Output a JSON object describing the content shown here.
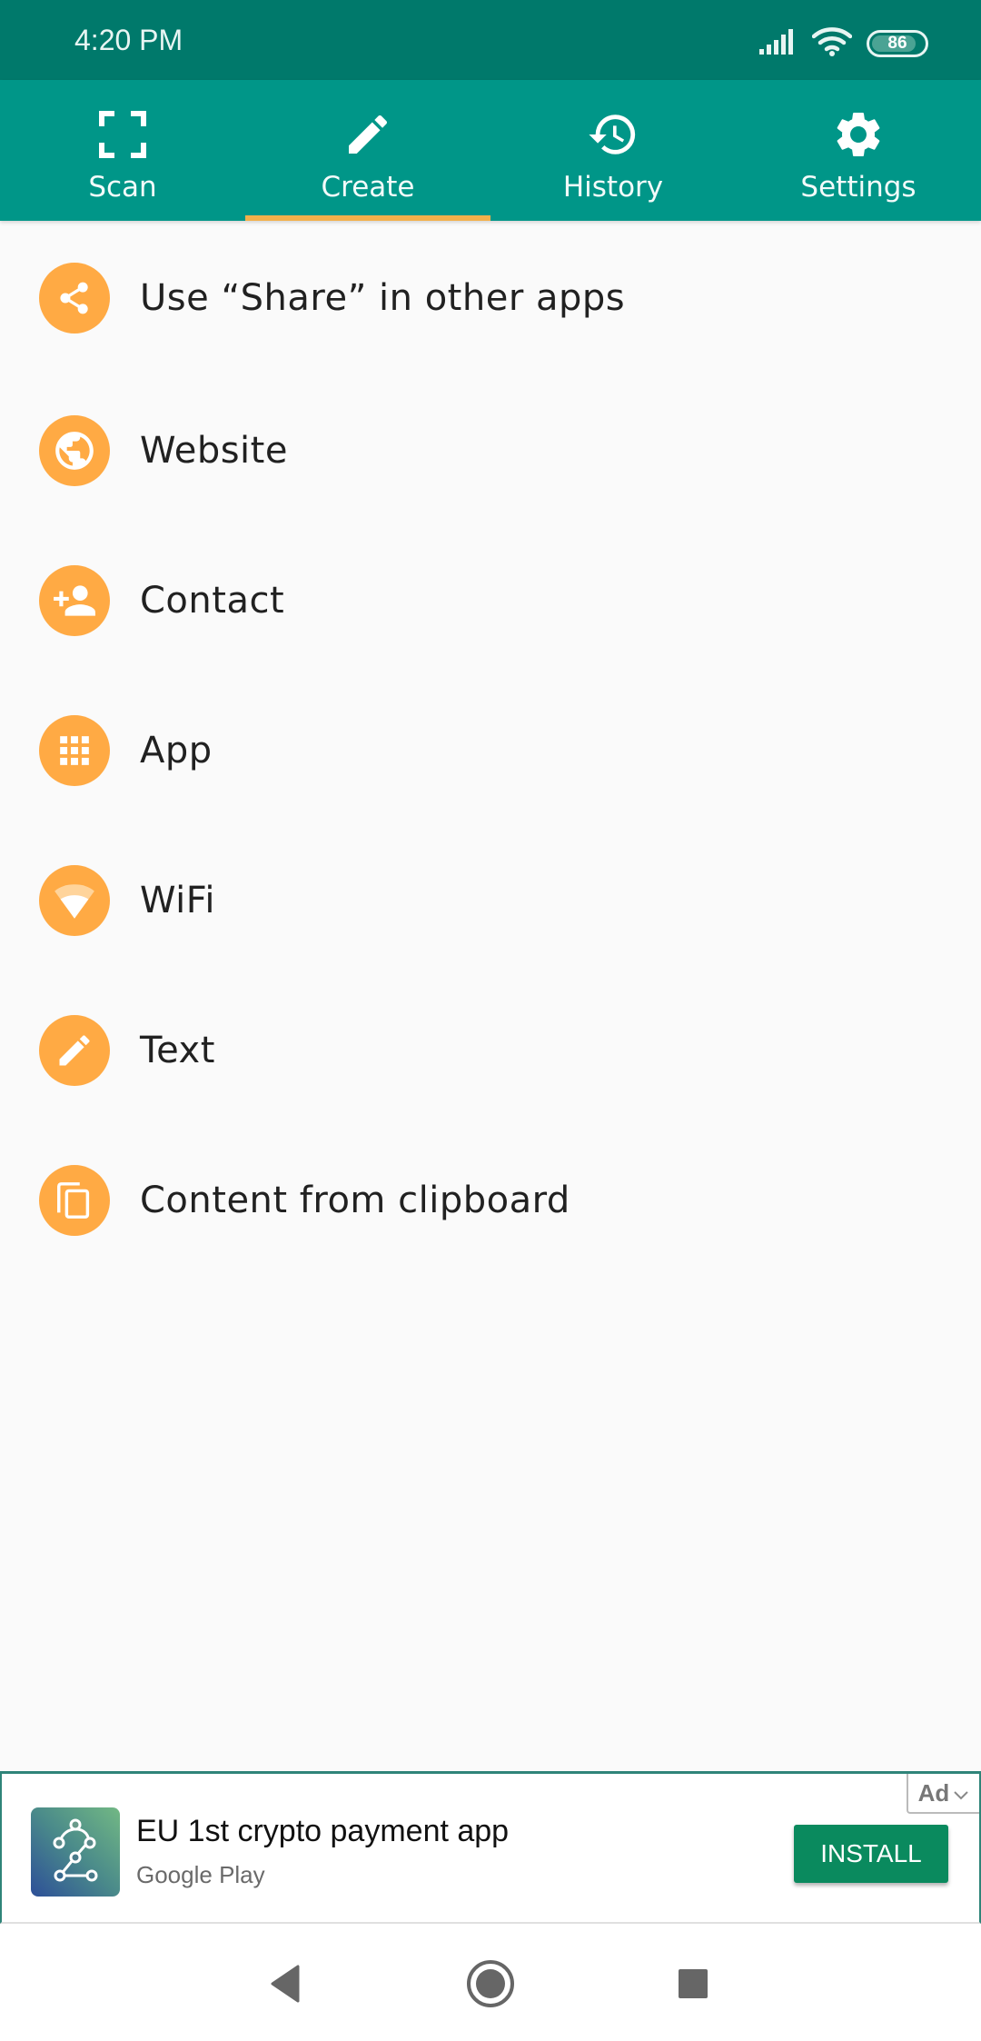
{
  "status_bar": {
    "time": "4:20 PM",
    "battery_level": "86",
    "icons": [
      "signal-icon",
      "wifi-icon",
      "battery-icon"
    ]
  },
  "tabs": [
    {
      "label": "Scan",
      "icon": "scan-frame-icon",
      "active": false
    },
    {
      "label": "Create",
      "icon": "pencil-icon",
      "active": true
    },
    {
      "label": "History",
      "icon": "history-icon",
      "active": false
    },
    {
      "label": "Settings",
      "icon": "gear-icon",
      "active": false
    }
  ],
  "create_options": [
    {
      "label": "Use “Share” in other apps",
      "icon": "share-icon"
    },
    {
      "label": "Website",
      "icon": "globe-icon"
    },
    {
      "label": "Contact",
      "icon": "add-contact-icon"
    },
    {
      "label": "App",
      "icon": "app-grid-icon"
    },
    {
      "label": "WiFi",
      "icon": "wifi-icon"
    },
    {
      "label": "Text",
      "icon": "pencil-icon"
    },
    {
      "label": "Content from clipboard",
      "icon": "clipboard-copy-icon"
    }
  ],
  "ad": {
    "title": "EU 1st crypto payment app",
    "subtitle": "Google Play",
    "install_label": "INSTALL",
    "badge_label": "Ad"
  },
  "colors": {
    "status_bar": "#00796b",
    "tab_bar": "#009688",
    "tab_indicator": "#f2b04b",
    "icon_accent": "#ffaa44",
    "install_button": "#0a8a5e"
  }
}
